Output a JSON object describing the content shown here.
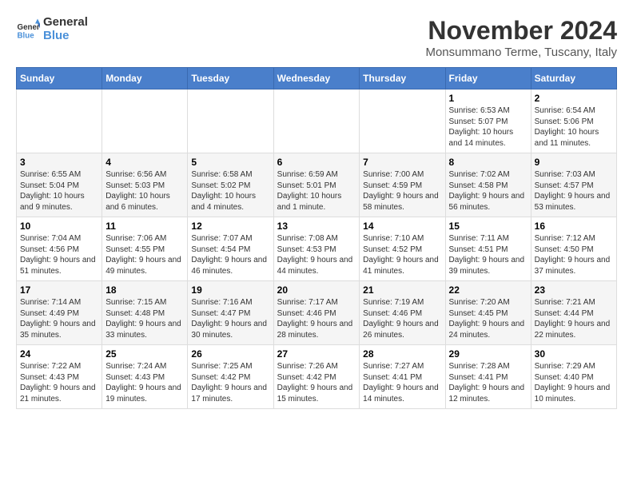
{
  "header": {
    "logo_line1": "General",
    "logo_line2": "Blue",
    "month_year": "November 2024",
    "location": "Monsummano Terme, Tuscany, Italy"
  },
  "days_of_week": [
    "Sunday",
    "Monday",
    "Tuesday",
    "Wednesday",
    "Thursday",
    "Friday",
    "Saturday"
  ],
  "weeks": [
    [
      {
        "day": "",
        "info": ""
      },
      {
        "day": "",
        "info": ""
      },
      {
        "day": "",
        "info": ""
      },
      {
        "day": "",
        "info": ""
      },
      {
        "day": "",
        "info": ""
      },
      {
        "day": "1",
        "info": "Sunrise: 6:53 AM\nSunset: 5:07 PM\nDaylight: 10 hours and 14 minutes."
      },
      {
        "day": "2",
        "info": "Sunrise: 6:54 AM\nSunset: 5:06 PM\nDaylight: 10 hours and 11 minutes."
      }
    ],
    [
      {
        "day": "3",
        "info": "Sunrise: 6:55 AM\nSunset: 5:04 PM\nDaylight: 10 hours and 9 minutes."
      },
      {
        "day": "4",
        "info": "Sunrise: 6:56 AM\nSunset: 5:03 PM\nDaylight: 10 hours and 6 minutes."
      },
      {
        "day": "5",
        "info": "Sunrise: 6:58 AM\nSunset: 5:02 PM\nDaylight: 10 hours and 4 minutes."
      },
      {
        "day": "6",
        "info": "Sunrise: 6:59 AM\nSunset: 5:01 PM\nDaylight: 10 hours and 1 minute."
      },
      {
        "day": "7",
        "info": "Sunrise: 7:00 AM\nSunset: 4:59 PM\nDaylight: 9 hours and 58 minutes."
      },
      {
        "day": "8",
        "info": "Sunrise: 7:02 AM\nSunset: 4:58 PM\nDaylight: 9 hours and 56 minutes."
      },
      {
        "day": "9",
        "info": "Sunrise: 7:03 AM\nSunset: 4:57 PM\nDaylight: 9 hours and 53 minutes."
      }
    ],
    [
      {
        "day": "10",
        "info": "Sunrise: 7:04 AM\nSunset: 4:56 PM\nDaylight: 9 hours and 51 minutes."
      },
      {
        "day": "11",
        "info": "Sunrise: 7:06 AM\nSunset: 4:55 PM\nDaylight: 9 hours and 49 minutes."
      },
      {
        "day": "12",
        "info": "Sunrise: 7:07 AM\nSunset: 4:54 PM\nDaylight: 9 hours and 46 minutes."
      },
      {
        "day": "13",
        "info": "Sunrise: 7:08 AM\nSunset: 4:53 PM\nDaylight: 9 hours and 44 minutes."
      },
      {
        "day": "14",
        "info": "Sunrise: 7:10 AM\nSunset: 4:52 PM\nDaylight: 9 hours and 41 minutes."
      },
      {
        "day": "15",
        "info": "Sunrise: 7:11 AM\nSunset: 4:51 PM\nDaylight: 9 hours and 39 minutes."
      },
      {
        "day": "16",
        "info": "Sunrise: 7:12 AM\nSunset: 4:50 PM\nDaylight: 9 hours and 37 minutes."
      }
    ],
    [
      {
        "day": "17",
        "info": "Sunrise: 7:14 AM\nSunset: 4:49 PM\nDaylight: 9 hours and 35 minutes."
      },
      {
        "day": "18",
        "info": "Sunrise: 7:15 AM\nSunset: 4:48 PM\nDaylight: 9 hours and 33 minutes."
      },
      {
        "day": "19",
        "info": "Sunrise: 7:16 AM\nSunset: 4:47 PM\nDaylight: 9 hours and 30 minutes."
      },
      {
        "day": "20",
        "info": "Sunrise: 7:17 AM\nSunset: 4:46 PM\nDaylight: 9 hours and 28 minutes."
      },
      {
        "day": "21",
        "info": "Sunrise: 7:19 AM\nSunset: 4:46 PM\nDaylight: 9 hours and 26 minutes."
      },
      {
        "day": "22",
        "info": "Sunrise: 7:20 AM\nSunset: 4:45 PM\nDaylight: 9 hours and 24 minutes."
      },
      {
        "day": "23",
        "info": "Sunrise: 7:21 AM\nSunset: 4:44 PM\nDaylight: 9 hours and 22 minutes."
      }
    ],
    [
      {
        "day": "24",
        "info": "Sunrise: 7:22 AM\nSunset: 4:43 PM\nDaylight: 9 hours and 21 minutes."
      },
      {
        "day": "25",
        "info": "Sunrise: 7:24 AM\nSunset: 4:43 PM\nDaylight: 9 hours and 19 minutes."
      },
      {
        "day": "26",
        "info": "Sunrise: 7:25 AM\nSunset: 4:42 PM\nDaylight: 9 hours and 17 minutes."
      },
      {
        "day": "27",
        "info": "Sunrise: 7:26 AM\nSunset: 4:42 PM\nDaylight: 9 hours and 15 minutes."
      },
      {
        "day": "28",
        "info": "Sunrise: 7:27 AM\nSunset: 4:41 PM\nDaylight: 9 hours and 14 minutes."
      },
      {
        "day": "29",
        "info": "Sunrise: 7:28 AM\nSunset: 4:41 PM\nDaylight: 9 hours and 12 minutes."
      },
      {
        "day": "30",
        "info": "Sunrise: 7:29 AM\nSunset: 4:40 PM\nDaylight: 9 hours and 10 minutes."
      }
    ]
  ]
}
